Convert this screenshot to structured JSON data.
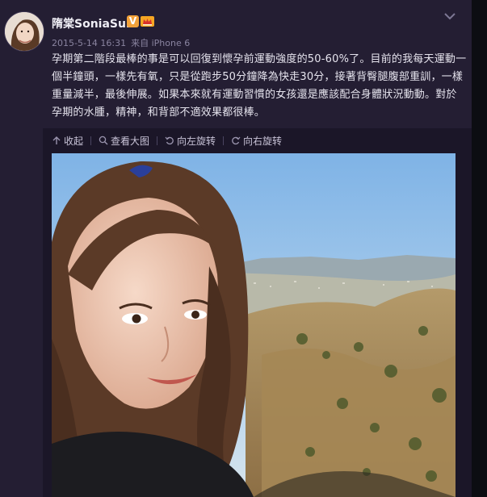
{
  "user": {
    "name": "隋棠SoniaSui",
    "verified_badge": "V"
  },
  "meta": {
    "timestamp": "2015-5-14 16:31",
    "source": "来自 iPhone 6"
  },
  "post": {
    "text": "孕期第二階段最棒的事是可以回復到懷孕前運動強度的50-60%了。目前的我每天運動一個半鐘頭，一樣先有氧，只是從跑步50分鐘降為快走30分，接著背臀腿腹部重訓，一樣重量減半，最後伸展。如果本來就有運動習慣的女孩還是應該配合身體狀況動動。對於孕期的水腫，精神，和背部不適效果都很棒。"
  },
  "toolbar": {
    "collect": "收起",
    "view_large": "查看大图",
    "rotate_left": "向左旋转",
    "rotate_right": "向右旋转"
  },
  "colors": {
    "card_bg": "#241e33",
    "verified_orange": "#f3a23a",
    "text": "#e6e4ee",
    "meta": "#8a84a0"
  },
  "icons": {
    "collapse": "chevron-down-icon",
    "collect": "arrow-up-icon",
    "view_large": "magnifier-icon",
    "rotate_left": "rotate-left-icon",
    "rotate_right": "rotate-right-icon"
  }
}
